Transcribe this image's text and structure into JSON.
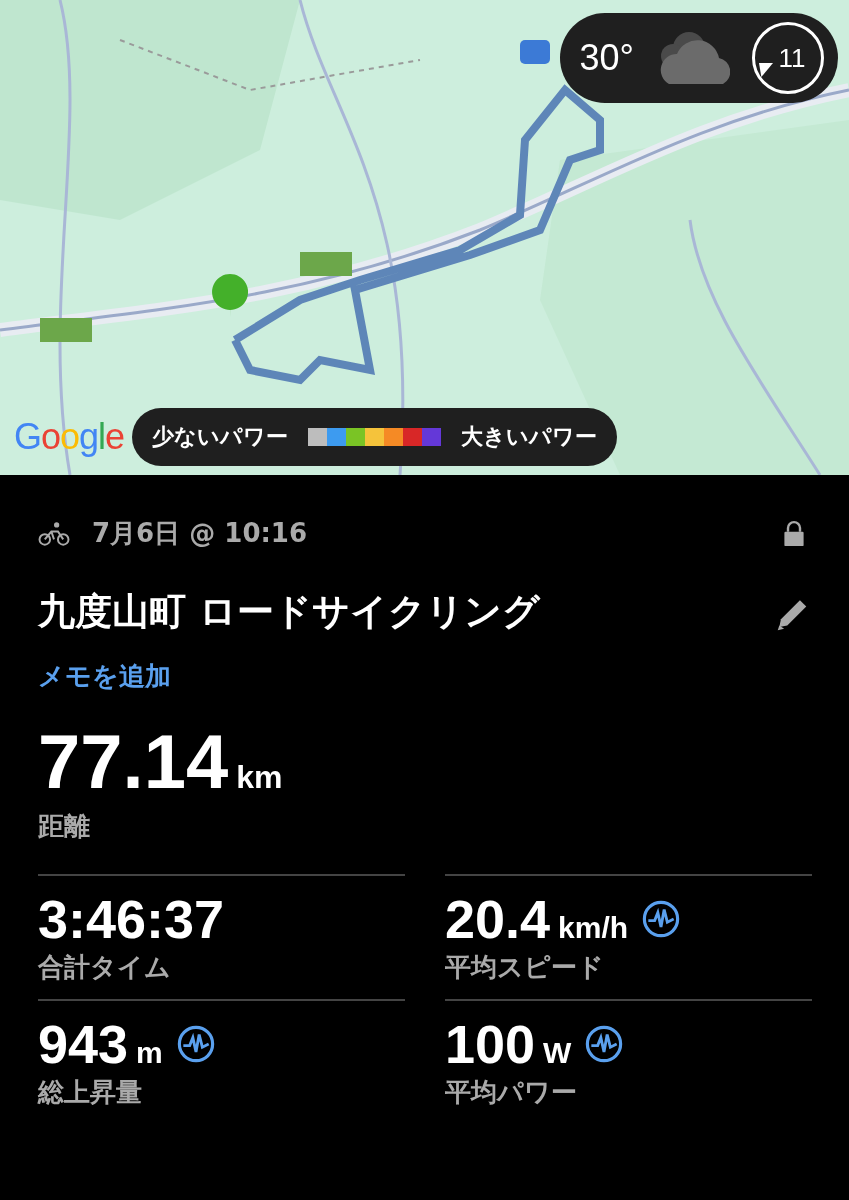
{
  "map": {
    "weather": {
      "temperature": "30°",
      "wind": "11"
    },
    "logo": "Google",
    "legend": {
      "low_label": "少ないパワー",
      "high_label": "大きいパワー",
      "swatches": [
        {
          "color": "#bdbdbd"
        },
        {
          "color": "#3d9bf0"
        },
        {
          "color": "#7ac425"
        },
        {
          "color": "#f5c33b"
        },
        {
          "color": "#f58a25"
        },
        {
          "color": "#d82727"
        },
        {
          "color": "#6438d8"
        }
      ]
    }
  },
  "activity": {
    "date": "7月6日 @ 10:16",
    "locked": true,
    "title": "九度山町 ロードサイクリング",
    "memo_link": "メモを追加"
  },
  "headline": {
    "value": "77.14",
    "unit": "km",
    "label": "距離"
  },
  "stats": [
    {
      "value": "3:46:37",
      "label": "合計タイム",
      "chart": false
    },
    {
      "value": "20.4",
      "unit": "km/h",
      "label": "平均スピード",
      "chart": true
    },
    {
      "value": "943",
      "unit": "m",
      "label": "総上昇量",
      "chart": true
    },
    {
      "value": "100",
      "unit": "W",
      "label": "平均パワー",
      "chart": true
    }
  ]
}
